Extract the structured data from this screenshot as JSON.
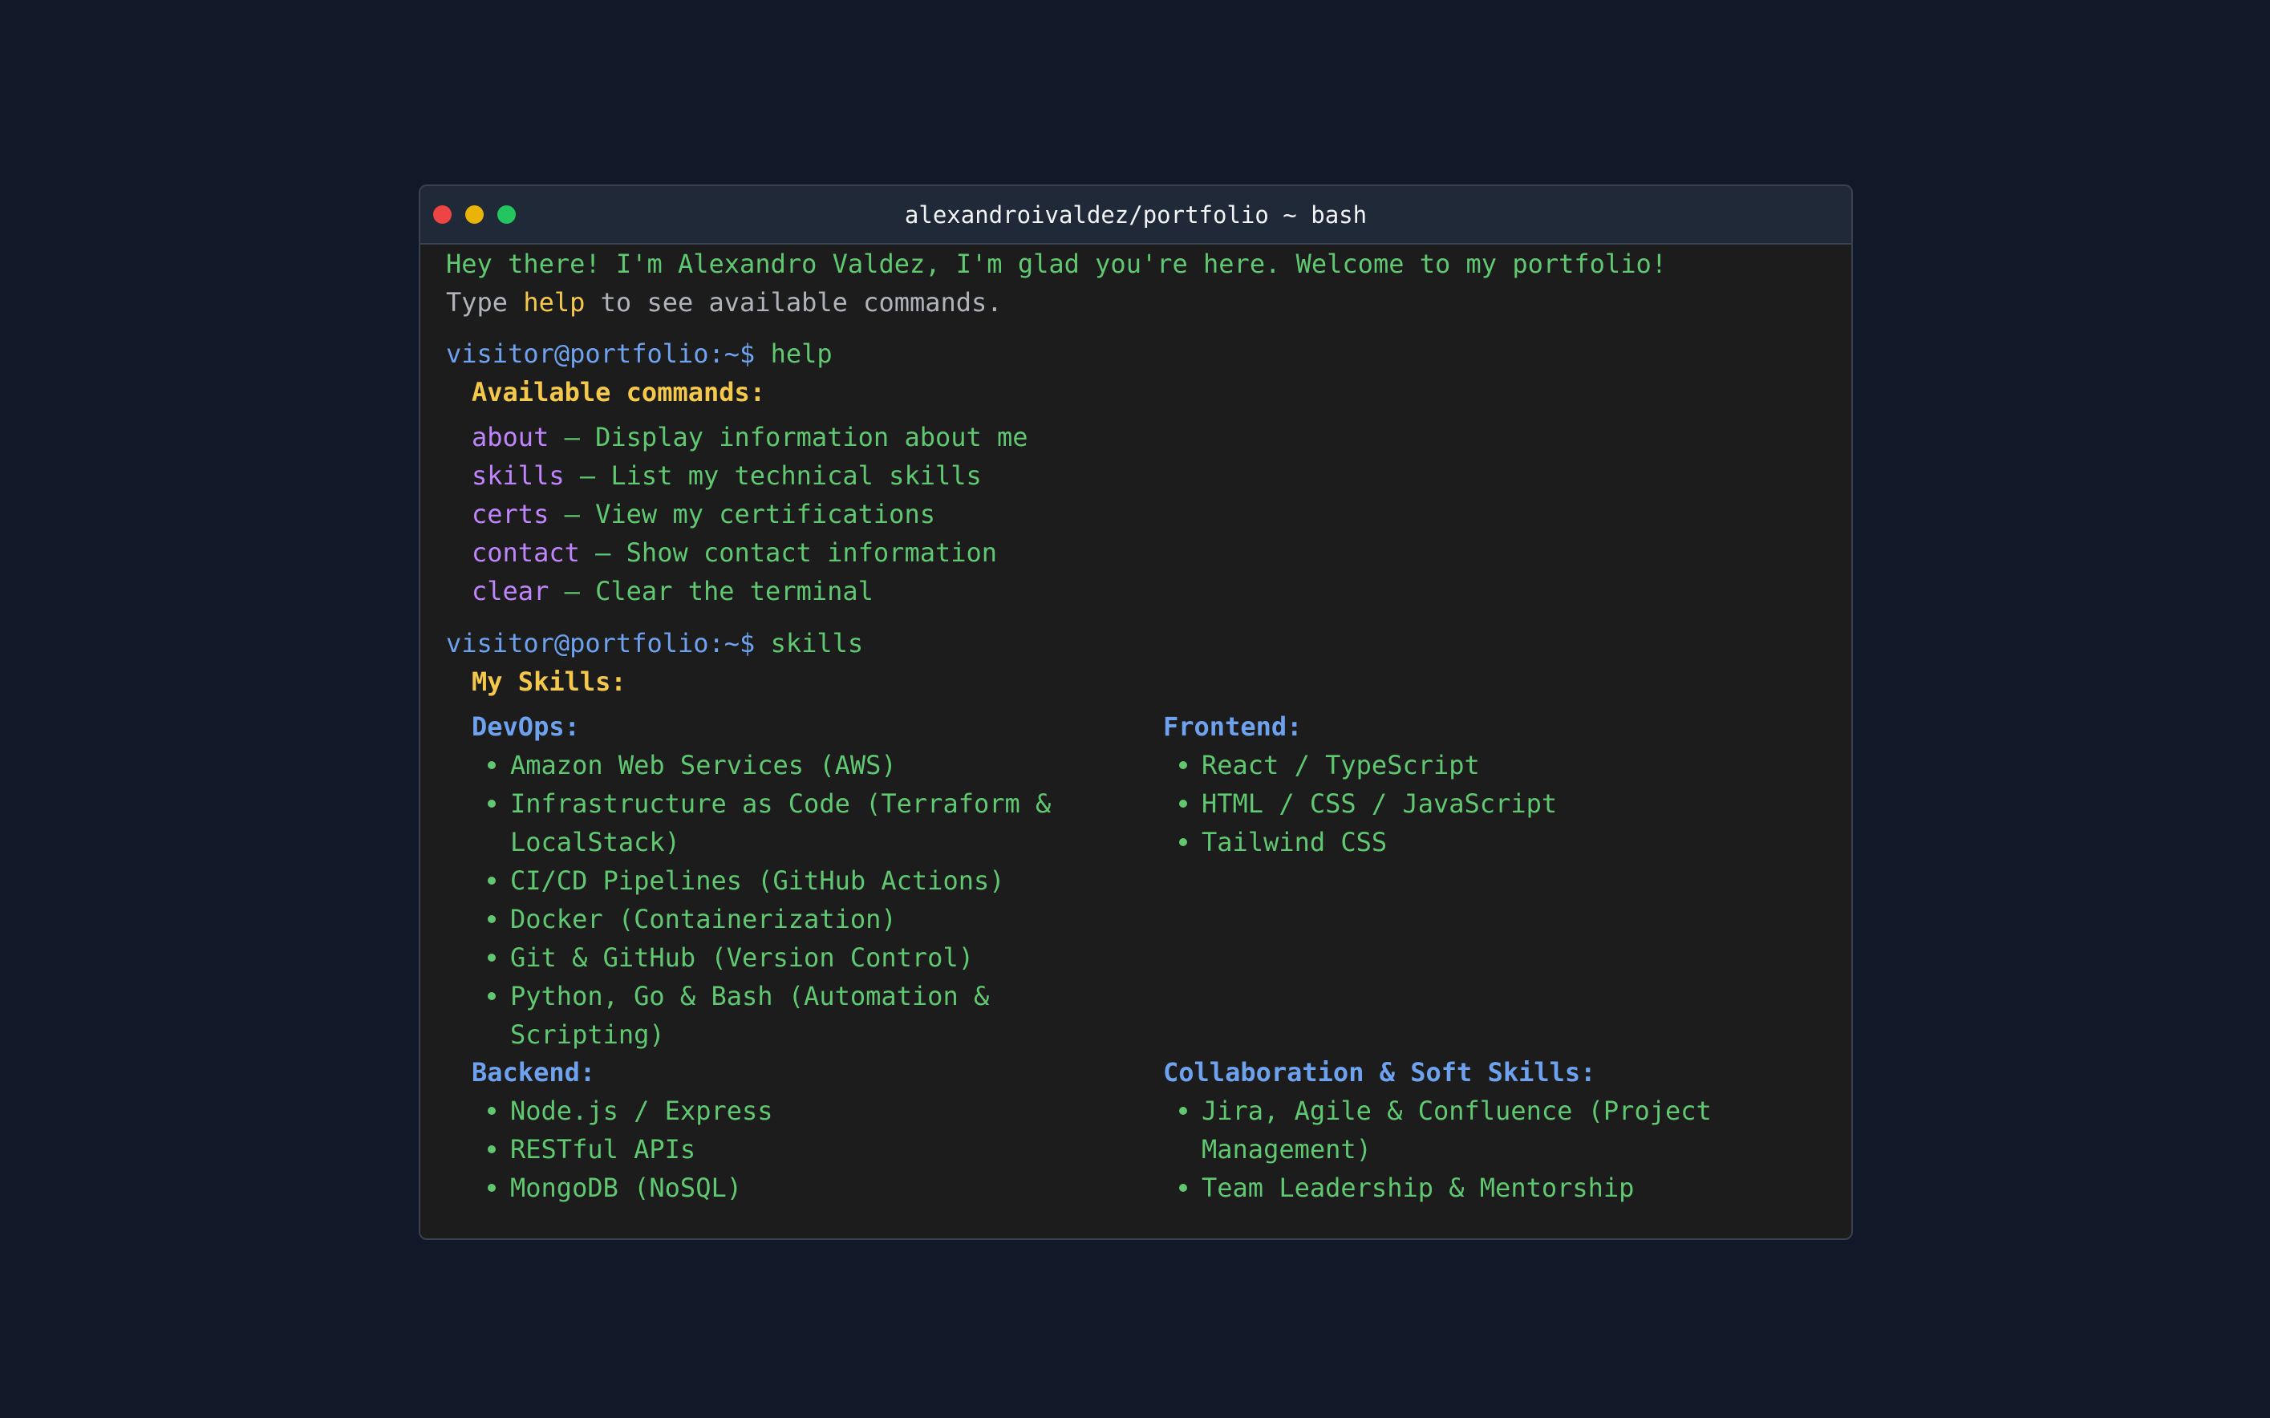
{
  "window": {
    "title": "alexandroivaldez/portfolio ~ bash"
  },
  "welcome": {
    "greeting": "Hey there! I'm Alexandro Valdez, I'm glad you're here. Welcome to my portfolio!",
    "hint_prefix": "Type ",
    "hint_keyword": "help",
    "hint_suffix": " to see available commands."
  },
  "prompt": "visitor@portfolio:~$",
  "session": {
    "cmd1": "help",
    "help_heading": "Available commands:",
    "commands": [
      {
        "name": "about",
        "desc": " – Display information about me"
      },
      {
        "name": "skills",
        "desc": " – List my technical skills"
      },
      {
        "name": "certs",
        "desc": " – View my certifications"
      },
      {
        "name": "contact",
        "desc": " – Show contact information"
      },
      {
        "name": "clear",
        "desc": " – Clear the terminal"
      }
    ],
    "cmd2": "skills",
    "skills_heading": "My Skills:",
    "categories": [
      {
        "name": "DevOps:",
        "items": [
          [
            "Amazon Web Services (AWS)"
          ],
          [
            "Infrastructure as Code (Terraform &",
            "LocalStack)"
          ],
          [
            "CI/CD Pipelines (GitHub Actions)"
          ],
          [
            "Docker (Containerization)"
          ],
          [
            "Git & GitHub (Version Control)"
          ],
          [
            "Python, Go & Bash (Automation &",
            "Scripting)"
          ]
        ]
      },
      {
        "name": "Frontend:",
        "items": [
          [
            "React / TypeScript"
          ],
          [
            "HTML / CSS / JavaScript"
          ],
          [
            "Tailwind CSS"
          ]
        ]
      },
      {
        "name": "Backend:",
        "items": [
          [
            "Node.js / Express"
          ],
          [
            "RESTful APIs"
          ],
          [
            "MongoDB (NoSQL)"
          ]
        ]
      },
      {
        "name": "Collaboration & Soft Skills:",
        "items": [
          [
            "Jira, Agile & Confluence (Project",
            "Management)"
          ],
          [
            "Team Leadership & Mentorship"
          ]
        ]
      }
    ]
  },
  "colors": {
    "page_bg": "#111827",
    "terminal_bg": "#1c1c1c",
    "titlebar_bg": "#1f2937",
    "text_green": "#5fc870",
    "prompt_blue": "#6ea2ee",
    "heading_yellow": "#f4c84a",
    "command_purple": "#c084fc",
    "dot_red": "#ef4444",
    "dot_yellow": "#eab308",
    "dot_green": "#22c55e"
  }
}
